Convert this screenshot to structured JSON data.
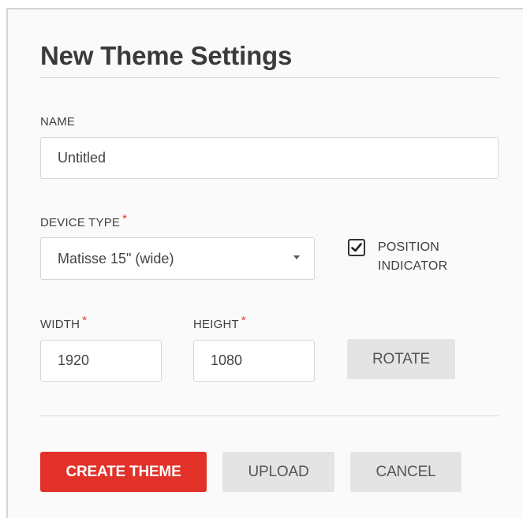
{
  "dialog": {
    "title": "New Theme Settings"
  },
  "name": {
    "label": "NAME",
    "value": "Untitled"
  },
  "device_type": {
    "label": "DEVICE TYPE",
    "required_mark": "*",
    "selected": "Matisse 15\" (wide)"
  },
  "position_indicator": {
    "checked": true,
    "label_line1": "POSITION",
    "label_line2": "INDICATOR"
  },
  "width": {
    "label": "WIDTH",
    "required_mark": "*",
    "value": "1920"
  },
  "height": {
    "label": "HEIGHT",
    "required_mark": "*",
    "value": "1080"
  },
  "buttons": {
    "rotate": "ROTATE",
    "create": "CREATE THEME",
    "upload": "UPLOAD",
    "cancel": "CANCEL"
  },
  "colors": {
    "primary": "#e23129",
    "required": "#e8352b",
    "secondary_button": "#e4e4e4"
  }
}
